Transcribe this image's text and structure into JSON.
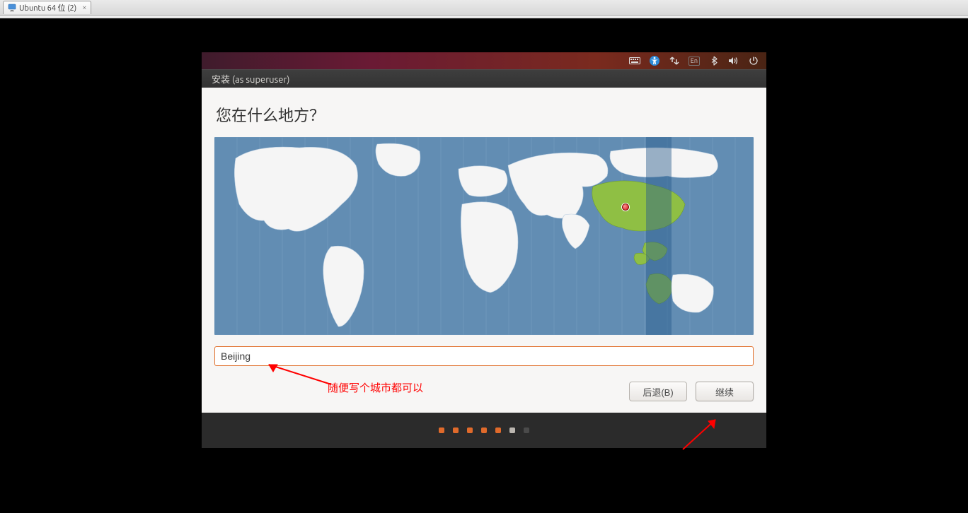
{
  "vm": {
    "tab_label": "Ubuntu 64 位 (2)"
  },
  "menubar": {
    "lang_indicator": "En"
  },
  "titlebar": {
    "title": "安装 (as superuser)"
  },
  "page": {
    "heading": "您在什么地方？"
  },
  "location": {
    "value": "Beijing"
  },
  "annotation": {
    "text": "随便写个城市都可以"
  },
  "buttons": {
    "back": "后退(B)",
    "continue": "继续"
  },
  "progress": {
    "total": 7,
    "active": 5
  }
}
